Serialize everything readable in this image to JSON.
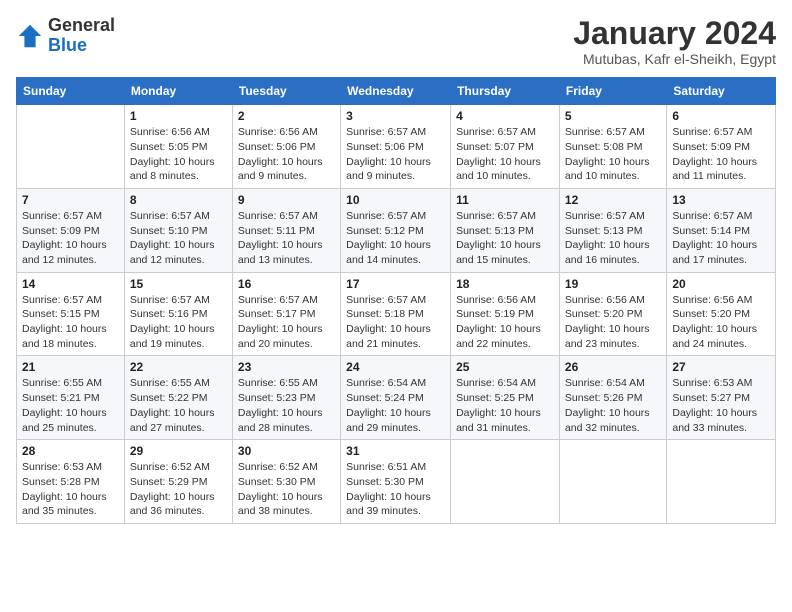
{
  "header": {
    "logo_line1": "General",
    "logo_line2": "Blue",
    "title": "January 2024",
    "subtitle": "Mutubas, Kafr el-Sheikh, Egypt"
  },
  "weekdays": [
    "Sunday",
    "Monday",
    "Tuesday",
    "Wednesday",
    "Thursday",
    "Friday",
    "Saturday"
  ],
  "weeks": [
    [
      {
        "day": "",
        "info": ""
      },
      {
        "day": "1",
        "info": "Sunrise: 6:56 AM\nSunset: 5:05 PM\nDaylight: 10 hours\nand 8 minutes."
      },
      {
        "day": "2",
        "info": "Sunrise: 6:56 AM\nSunset: 5:06 PM\nDaylight: 10 hours\nand 9 minutes."
      },
      {
        "day": "3",
        "info": "Sunrise: 6:57 AM\nSunset: 5:06 PM\nDaylight: 10 hours\nand 9 minutes."
      },
      {
        "day": "4",
        "info": "Sunrise: 6:57 AM\nSunset: 5:07 PM\nDaylight: 10 hours\nand 10 minutes."
      },
      {
        "day": "5",
        "info": "Sunrise: 6:57 AM\nSunset: 5:08 PM\nDaylight: 10 hours\nand 10 minutes."
      },
      {
        "day": "6",
        "info": "Sunrise: 6:57 AM\nSunset: 5:09 PM\nDaylight: 10 hours\nand 11 minutes."
      }
    ],
    [
      {
        "day": "7",
        "info": "Sunrise: 6:57 AM\nSunset: 5:09 PM\nDaylight: 10 hours\nand 12 minutes."
      },
      {
        "day": "8",
        "info": "Sunrise: 6:57 AM\nSunset: 5:10 PM\nDaylight: 10 hours\nand 12 minutes."
      },
      {
        "day": "9",
        "info": "Sunrise: 6:57 AM\nSunset: 5:11 PM\nDaylight: 10 hours\nand 13 minutes."
      },
      {
        "day": "10",
        "info": "Sunrise: 6:57 AM\nSunset: 5:12 PM\nDaylight: 10 hours\nand 14 minutes."
      },
      {
        "day": "11",
        "info": "Sunrise: 6:57 AM\nSunset: 5:13 PM\nDaylight: 10 hours\nand 15 minutes."
      },
      {
        "day": "12",
        "info": "Sunrise: 6:57 AM\nSunset: 5:13 PM\nDaylight: 10 hours\nand 16 minutes."
      },
      {
        "day": "13",
        "info": "Sunrise: 6:57 AM\nSunset: 5:14 PM\nDaylight: 10 hours\nand 17 minutes."
      }
    ],
    [
      {
        "day": "14",
        "info": "Sunrise: 6:57 AM\nSunset: 5:15 PM\nDaylight: 10 hours\nand 18 minutes."
      },
      {
        "day": "15",
        "info": "Sunrise: 6:57 AM\nSunset: 5:16 PM\nDaylight: 10 hours\nand 19 minutes."
      },
      {
        "day": "16",
        "info": "Sunrise: 6:57 AM\nSunset: 5:17 PM\nDaylight: 10 hours\nand 20 minutes."
      },
      {
        "day": "17",
        "info": "Sunrise: 6:57 AM\nSunset: 5:18 PM\nDaylight: 10 hours\nand 21 minutes."
      },
      {
        "day": "18",
        "info": "Sunrise: 6:56 AM\nSunset: 5:19 PM\nDaylight: 10 hours\nand 22 minutes."
      },
      {
        "day": "19",
        "info": "Sunrise: 6:56 AM\nSunset: 5:20 PM\nDaylight: 10 hours\nand 23 minutes."
      },
      {
        "day": "20",
        "info": "Sunrise: 6:56 AM\nSunset: 5:20 PM\nDaylight: 10 hours\nand 24 minutes."
      }
    ],
    [
      {
        "day": "21",
        "info": "Sunrise: 6:55 AM\nSunset: 5:21 PM\nDaylight: 10 hours\nand 25 minutes."
      },
      {
        "day": "22",
        "info": "Sunrise: 6:55 AM\nSunset: 5:22 PM\nDaylight: 10 hours\nand 27 minutes."
      },
      {
        "day": "23",
        "info": "Sunrise: 6:55 AM\nSunset: 5:23 PM\nDaylight: 10 hours\nand 28 minutes."
      },
      {
        "day": "24",
        "info": "Sunrise: 6:54 AM\nSunset: 5:24 PM\nDaylight: 10 hours\nand 29 minutes."
      },
      {
        "day": "25",
        "info": "Sunrise: 6:54 AM\nSunset: 5:25 PM\nDaylight: 10 hours\nand 31 minutes."
      },
      {
        "day": "26",
        "info": "Sunrise: 6:54 AM\nSunset: 5:26 PM\nDaylight: 10 hours\nand 32 minutes."
      },
      {
        "day": "27",
        "info": "Sunrise: 6:53 AM\nSunset: 5:27 PM\nDaylight: 10 hours\nand 33 minutes."
      }
    ],
    [
      {
        "day": "28",
        "info": "Sunrise: 6:53 AM\nSunset: 5:28 PM\nDaylight: 10 hours\nand 35 minutes."
      },
      {
        "day": "29",
        "info": "Sunrise: 6:52 AM\nSunset: 5:29 PM\nDaylight: 10 hours\nand 36 minutes."
      },
      {
        "day": "30",
        "info": "Sunrise: 6:52 AM\nSunset: 5:30 PM\nDaylight: 10 hours\nand 38 minutes."
      },
      {
        "day": "31",
        "info": "Sunrise: 6:51 AM\nSunset: 5:30 PM\nDaylight: 10 hours\nand 39 minutes."
      },
      {
        "day": "",
        "info": ""
      },
      {
        "day": "",
        "info": ""
      },
      {
        "day": "",
        "info": ""
      }
    ]
  ]
}
